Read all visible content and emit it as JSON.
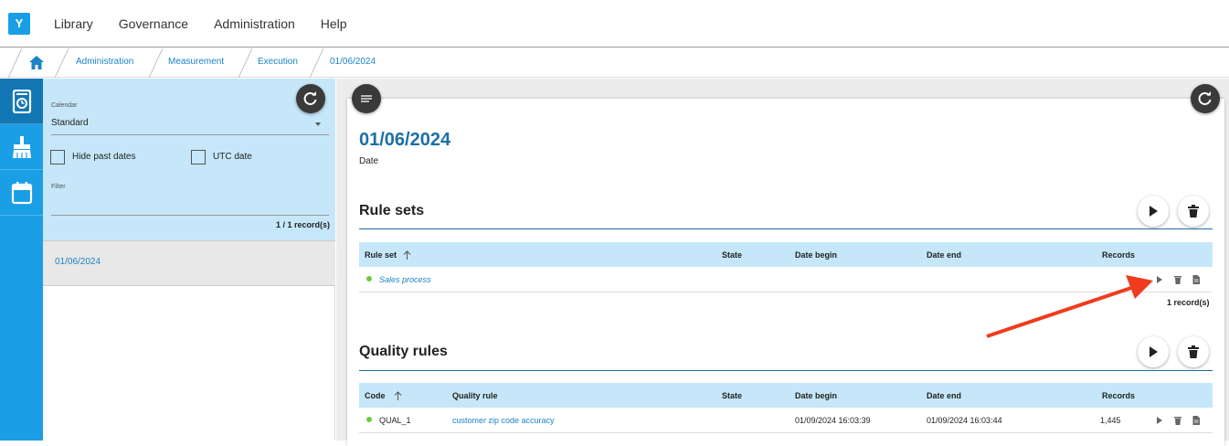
{
  "app": {
    "logo_letter": "Y",
    "nav": [
      "Library",
      "Governance",
      "Administration",
      "Help"
    ]
  },
  "breadcrumb": [
    "Administration",
    "Measurement",
    "Execution",
    "01/06/2024"
  ],
  "left_panel": {
    "calendar_label": "Calendar",
    "calendar_value": "Standard",
    "hide_past_label": "Hide past dates",
    "utc_label": "UTC date",
    "filter_label": "Filter",
    "record_count": "1 / 1 record(s)",
    "items": [
      "01/06/2024"
    ]
  },
  "detail": {
    "title": "01/06/2024",
    "subtitle": "Date",
    "rule_sets": {
      "title": "Rule sets",
      "columns": [
        "Rule set",
        "State",
        "Date begin",
        "Date end",
        "Records"
      ],
      "rows": [
        {
          "name": "Sales process",
          "state": "",
          "date_begin": "",
          "date_end": "",
          "records": ""
        }
      ],
      "record_count": "1 record(s)"
    },
    "quality_rules": {
      "title": "Quality rules",
      "columns": [
        "Code",
        "Quality rule",
        "State",
        "Date begin",
        "Date end",
        "Records"
      ],
      "rows": [
        {
          "code": "QUAL_1",
          "rule": "customer zip code accuracy",
          "state": "",
          "date_begin": "01/09/2024 16:03:39",
          "date_end": "01/09/2024 16:03:44",
          "records": "1,445"
        }
      ]
    }
  },
  "colors": {
    "accent": "#1a9ee6",
    "panel": "#c5e7f9",
    "status_ok": "#6bcb3b",
    "annotation_arrow": "#f03c1e"
  }
}
